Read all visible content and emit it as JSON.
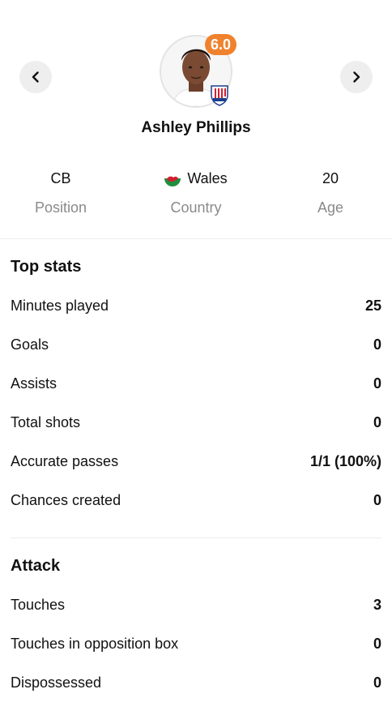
{
  "player": {
    "name": "Ashley Phillips",
    "rating": "6.0"
  },
  "info": [
    {
      "value": "CB",
      "label": "Position"
    },
    {
      "value": "Wales",
      "label": "Country"
    },
    {
      "value": "20",
      "label": "Age"
    }
  ],
  "sections": {
    "top_stats": {
      "title": "Top stats",
      "rows": [
        {
          "label": "Minutes played",
          "value": "25"
        },
        {
          "label": "Goals",
          "value": "0"
        },
        {
          "label": "Assists",
          "value": "0"
        },
        {
          "label": "Total shots",
          "value": "0"
        },
        {
          "label": "Accurate passes",
          "value": "1/1 (100%)"
        },
        {
          "label": "Chances created",
          "value": "0"
        }
      ]
    },
    "attack": {
      "title": "Attack",
      "rows": [
        {
          "label": "Touches",
          "value": "3"
        },
        {
          "label": "Touches in opposition box",
          "value": "0"
        },
        {
          "label": "Dispossessed",
          "value": "0"
        }
      ]
    }
  },
  "colors": {
    "rating_bg": "#f0822d",
    "muted_label": "#8a8a8a",
    "nav_button_bg": "#eeeeee"
  },
  "icons": {
    "prev": "chevron-left-icon",
    "next": "chevron-right-icon",
    "flag": "wales-flag-icon",
    "club": "stoke-city-badge-icon"
  }
}
